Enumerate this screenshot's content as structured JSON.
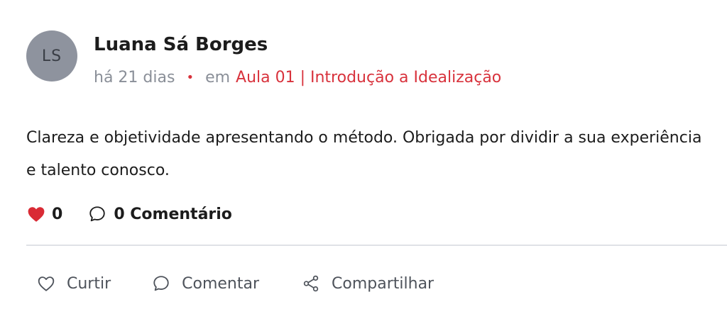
{
  "post": {
    "author": {
      "initials": "LS",
      "name": "Luana Sá Borges"
    },
    "meta": {
      "time": "há 21 dias",
      "separator": "•",
      "prefix": "em",
      "lesson": "Aula 01 | Introdução a Idealização"
    },
    "content": "Clareza e objetividade apresentando o método. Obrigada por dividir a sua experiência e talento conosco.",
    "stats": {
      "likes": "0",
      "comments": "0 Comentário"
    },
    "actions": {
      "like": "Curtir",
      "comment": "Comentar",
      "share": "Compartilhar"
    }
  },
  "colors": {
    "accent": "#d8323c",
    "heart": "#d92b35",
    "avatar_bg": "#8e939e",
    "muted": "#8a8f98"
  },
  "icons": {
    "like_stat": "heart-filled-icon",
    "comment_stat": "speech-bubble-icon",
    "like_action": "heart-outline-icon",
    "comment_action": "speech-bubble-icon",
    "share_action": "share-icon"
  }
}
